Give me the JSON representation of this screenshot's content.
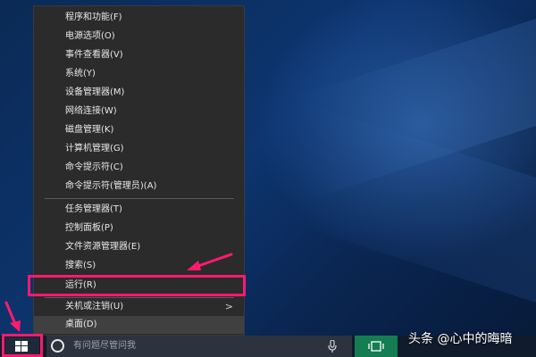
{
  "menu": {
    "items": [
      {
        "label": "程序和功能(F)"
      },
      {
        "label": "电源选项(O)"
      },
      {
        "label": "事件查看器(V)"
      },
      {
        "label": "系统(Y)"
      },
      {
        "label": "设备管理器(M)"
      },
      {
        "label": "网络连接(W)"
      },
      {
        "label": "磁盘管理(K)"
      },
      {
        "label": "计算机管理(G)"
      },
      {
        "label": "命令提示符(C)"
      },
      {
        "label": "命令提示符(管理员)(A)"
      },
      {
        "label": "任务管理器(T)"
      },
      {
        "label": "控制面板(P)"
      },
      {
        "label": "文件资源管理器(E)"
      },
      {
        "label": "搜索(S)"
      },
      {
        "label": "运行(R)"
      },
      {
        "label": "关机或注销(U)"
      },
      {
        "label": "桌面(D)"
      }
    ],
    "submenu_glyph": ">"
  },
  "taskbar": {
    "search_placeholder": "有问题尽管问我"
  },
  "watermark": {
    "text": "头条 @心中的晦暗"
  },
  "colors": {
    "highlight_border": "#ff1a6e",
    "menu_bg": "#2b2b2b",
    "taskview_accent": "#147d52"
  }
}
